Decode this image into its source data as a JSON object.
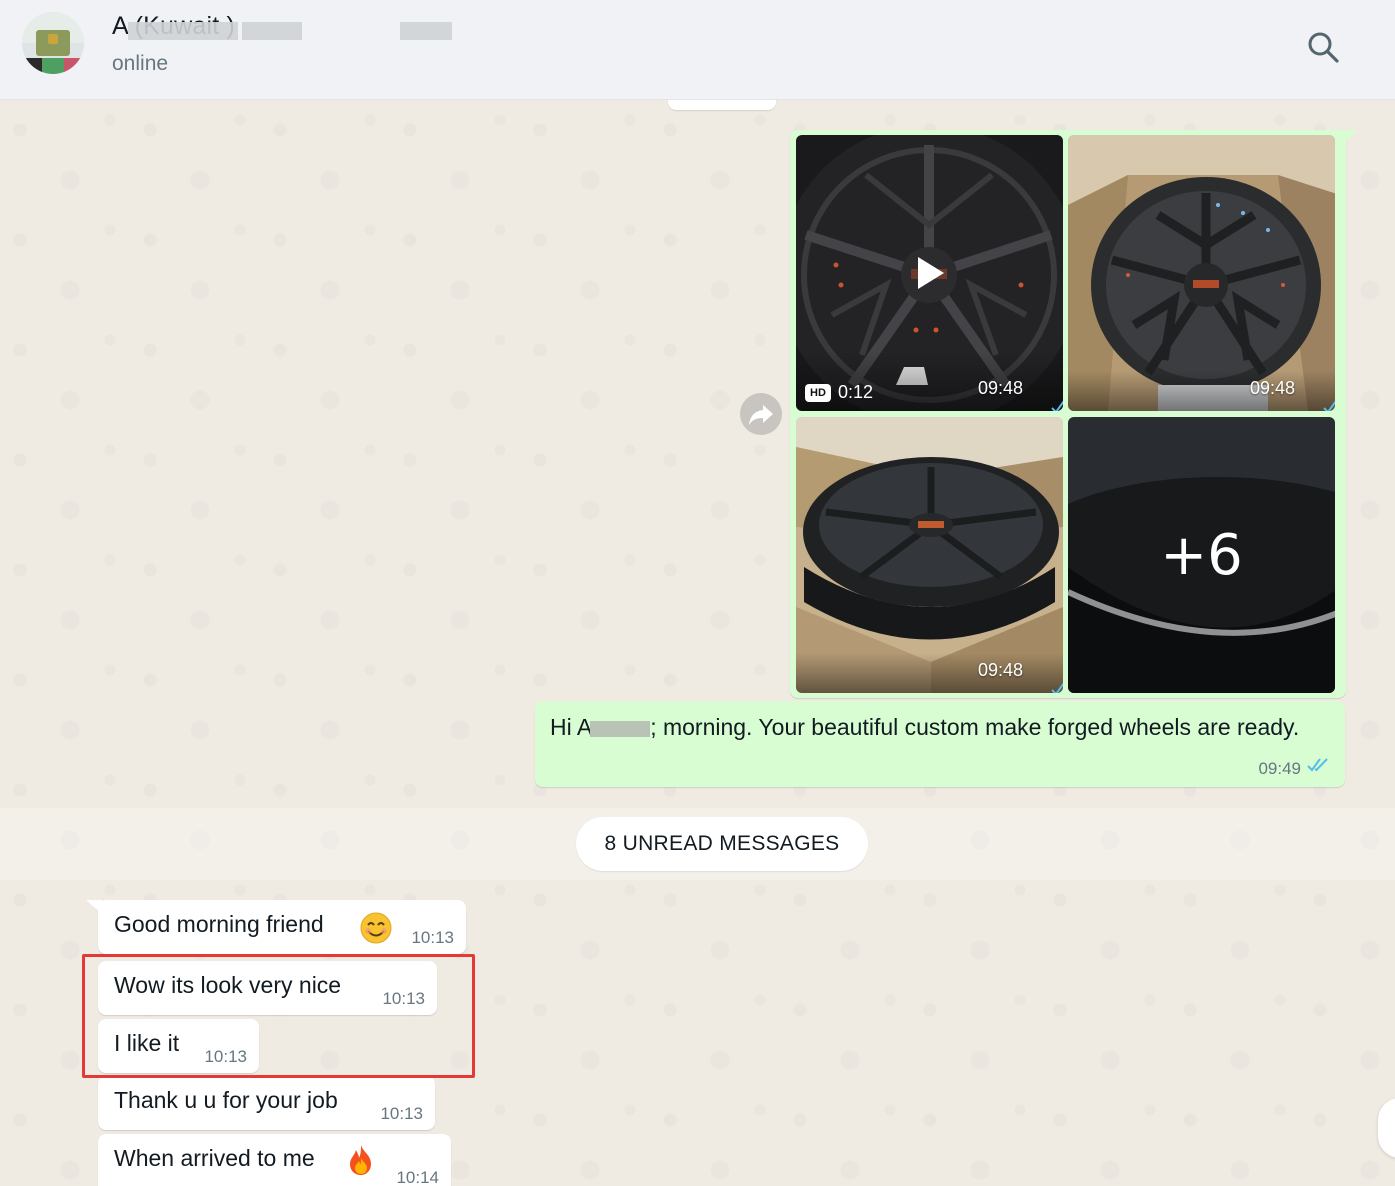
{
  "header": {
    "contact_name": "A       (Kuwait    )",
    "status": "online"
  },
  "media_message": {
    "tiles": [
      {
        "time": "09:48",
        "hd_label": "HD",
        "duration": "0:12"
      },
      {
        "time": "09:48"
      },
      {
        "time": "09:48"
      },
      {
        "more_count": "+6"
      }
    ]
  },
  "outgoing_message": {
    "text_before": "Hi A",
    "text_after": "; morning. Your beautiful custom make forged wheels are ready.",
    "time": "09:49"
  },
  "unread_divider": {
    "label": "8 UNREAD MESSAGES"
  },
  "incoming_messages": [
    {
      "text": "Good morning friend",
      "emoji": "smiling-face",
      "time": "10:13"
    },
    {
      "text": "Wow its look very nice",
      "time": "10:13"
    },
    {
      "text": "I like it",
      "time": "10:13"
    },
    {
      "text": "Thank u u for your job",
      "time": "10:13"
    },
    {
      "text": "When arrived to me",
      "emoji": "fire",
      "time": "10:14"
    }
  ],
  "colors": {
    "outgoing_bubble": "#d9fdd3",
    "incoming_bubble": "#ffffff",
    "read_tick": "#53bdeb",
    "highlight": "#e53935",
    "chat_background": "#efeae2"
  }
}
